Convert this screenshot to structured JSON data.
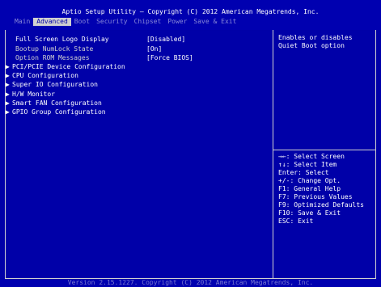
{
  "header": {
    "title": "Aptio Setup Utility – Copyright (C) 2012 American Megatrends, Inc.",
    "tabs": [
      {
        "label": "Main",
        "active": false
      },
      {
        "label": "Advanced",
        "active": true
      },
      {
        "label": "Boot",
        "active": false
      },
      {
        "label": "Security",
        "active": false
      },
      {
        "label": "Chipset",
        "active": false
      },
      {
        "label": "Power",
        "active": false
      },
      {
        "label": "Save & Exit",
        "active": false
      }
    ]
  },
  "settings": [
    {
      "label": "Full Screen Logo Display",
      "value": "[Disabled]",
      "selected": true
    },
    {
      "label": "Bootup NumLock State",
      "value": "[On]",
      "selected": false
    },
    {
      "label": "Option ROM Messages",
      "value": "[Force BIOS]",
      "selected": false
    }
  ],
  "submenus": [
    {
      "arrow": "▶",
      "label": "PCI/PCIE Device Configuration"
    },
    {
      "arrow": "▶",
      "label": "CPU Configuration"
    },
    {
      "arrow": "▶",
      "label": "Super IO Configuration"
    },
    {
      "arrow": "▶",
      "label": "H/W Monitor"
    },
    {
      "arrow": "▶",
      "label": "Smart FAN Configuration"
    },
    {
      "arrow": "▶",
      "label": "GPIO Group Configuration"
    }
  ],
  "help": {
    "text": "Enables or disables Quiet Boot option"
  },
  "keys": [
    "→←: Select Screen",
    "↑↓: Select Item",
    "Enter: Select",
    "+/-: Change Opt.",
    "F1: General Help",
    "F7: Previous Values",
    "F9: Optimized Defaults",
    "F10: Save & Exit",
    "ESC: Exit"
  ],
  "footer": {
    "version": "Version 2.15.1227. Copyright (C) 2012 American Megatrends, Inc."
  },
  "colors": {
    "background": "#0000a8",
    "text": "#ffffff",
    "inactive_text": "#d0d0d0",
    "active_tab_bg": "#d0d0d0"
  }
}
